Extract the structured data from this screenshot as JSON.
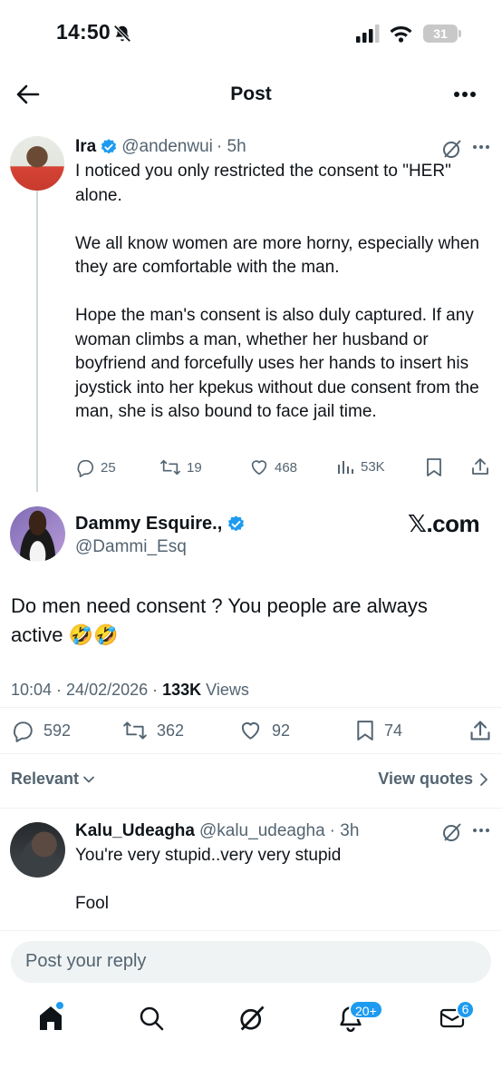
{
  "status_bar": {
    "time": "14:50",
    "battery": "31",
    "icons": [
      "bell-slash-icon",
      "cellular-signal-icon",
      "wifi-icon",
      "battery-icon"
    ]
  },
  "header": {
    "title": "Post",
    "icons": [
      "back-arrow-icon",
      "more-icon"
    ]
  },
  "parent_tweet": {
    "name": "Ira",
    "handle": "@andenwui",
    "time": "· 5h",
    "text": "I noticed you only restricted the consent to \"HER\" alone.\n\nWe all know women are more horny, especially when they are comfortable with the man.\n\nHope the man's consent is also duly captured. If any woman climbs a man, whether her husband or boyfriend and forcefully uses her hands to insert his joystick into her kpekus without due consent from the man, she is also bound to face jail time.",
    "replies": "25",
    "reposts": "19",
    "likes": "468",
    "views": "53K"
  },
  "main_tweet": {
    "name": "Dammy Esquire.,",
    "handle": "@Dammi_Esq",
    "watermark": "𝕏.com",
    "text": "Do men need consent ? You people are always active 🤣🤣",
    "timestamp": "10:04 · 24/02/2026 · ",
    "views_count": "133K",
    "views_label": " Views",
    "replies": "592",
    "reposts": "362",
    "likes": "92",
    "bookmarks": "74"
  },
  "sort": {
    "relevant_label": "Relevant",
    "view_quotes_label": "View quotes"
  },
  "reply_tweet": {
    "name": "Kalu_Udeagha",
    "handle": "@kalu_udeagha",
    "time": "· 3h",
    "text": "You're very stupid..very very stupid\n\nFool"
  },
  "reply_box": {
    "placeholder": "Post your reply"
  },
  "bottom_nav": {
    "items": [
      "home-icon",
      "search-icon",
      "grok-icon",
      "notifications-icon",
      "messages-icon"
    ],
    "notifications_badge": "20+",
    "messages_badge": "6"
  },
  "colors": {
    "accent": "#1d9bf0",
    "text": "#0f1419",
    "muted": "#536471",
    "divider": "#eff3f4"
  }
}
